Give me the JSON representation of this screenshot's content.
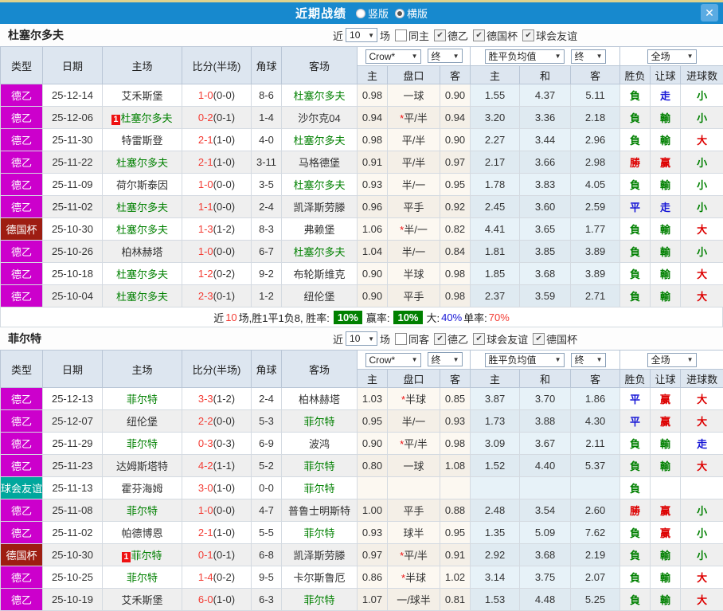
{
  "colors": {
    "topbar": "#1789ce",
    "strip": "#dfd28d",
    "close": "#5aabe3",
    "header_bg": "#dde6f0",
    "header_border": "#b9c6d6",
    "border": "#d4dae1",
    "row_odd": "#efefef",
    "odds_bg": "#fcf8f1",
    "odds_bg_alt": "#f4efe7",
    "avg_bg": "#e7f2f8",
    "avg_bg_alt": "#dfeaf1",
    "focus": "#008000",
    "score": "#f33b33",
    "res_red": "#dd0000",
    "res_green": "#008000",
    "res_blue": "#1616d6",
    "badge_green": "#008000",
    "badge_red": "#ee1111"
  },
  "league_colors": {
    "德乙": "#cc00cc",
    "德国杯": "#9e1d12",
    "球会友谊": "#00a79d"
  },
  "result_color_map": {
    "勝": "red",
    "赢": "red",
    "大": "red",
    "負": "green",
    "輸": "green",
    "小": "green",
    "平": "blue",
    "走": "blue"
  },
  "topbar": {
    "title": "近期战绩",
    "close_label": "✕",
    "radios": [
      {
        "label": "竖版",
        "checked": false
      },
      {
        "label": "横版",
        "checked": true
      }
    ]
  },
  "table_header": {
    "cols": [
      "类型",
      "日期",
      "主场",
      "比分(半场)",
      "角球",
      "客场"
    ],
    "group_odds": {
      "selects": [
        "Crow*",
        "终"
      ],
      "subcols": [
        "主",
        "盘口",
        "客"
      ]
    },
    "group_avg": {
      "selects": [
        "胜平负均值",
        "终"
      ],
      "subcols": [
        "主",
        "和",
        "客"
      ]
    },
    "group_result": {
      "selects": [
        "全场"
      ],
      "subcols": [
        "胜负",
        "让球",
        "进球数"
      ]
    }
  },
  "sections": [
    {
      "team": "杜塞尔多夫",
      "controls": {
        "prefix": "近",
        "count": "10",
        "suffix": "场",
        "filters": [
          {
            "label": "同主",
            "checked": false
          },
          {
            "label": "德乙",
            "checked": true
          },
          {
            "label": "德国杯",
            "checked": true
          },
          {
            "label": "球会友谊",
            "checked": true
          }
        ]
      },
      "rows": [
        {
          "league": "德乙",
          "date": "25-12-14",
          "home": "艾禾斯堡",
          "home_focus": false,
          "home_badge": "",
          "score": "1-0",
          "half": "(0-0)",
          "corner": "8-6",
          "away": "杜塞尔多夫",
          "away_focus": true,
          "away_badge": "",
          "odds": [
            "0.98",
            "一球",
            "0.90"
          ],
          "avg": [
            "1.55",
            "4.37",
            "5.11"
          ],
          "results": [
            "負",
            "走",
            "小"
          ]
        },
        {
          "league": "德乙",
          "date": "25-12-06",
          "home": "杜塞尔多夫",
          "home_focus": true,
          "home_badge": "1",
          "score": "0-2",
          "half": "(0-1)",
          "corner": "1-4",
          "away": "沙尔克04",
          "away_focus": false,
          "away_badge": "",
          "odds": [
            "0.94",
            "*平/半",
            "0.94"
          ],
          "avg": [
            "3.20",
            "3.36",
            "2.18"
          ],
          "results": [
            "負",
            "輸",
            "小"
          ]
        },
        {
          "league": "德乙",
          "date": "25-11-30",
          "home": "特雷斯登",
          "home_focus": false,
          "home_badge": "",
          "score": "2-1",
          "half": "(1-0)",
          "corner": "4-0",
          "away": "杜塞尔多夫",
          "away_focus": true,
          "away_badge": "",
          "odds": [
            "0.98",
            "平/半",
            "0.90"
          ],
          "avg": [
            "2.27",
            "3.44",
            "2.96"
          ],
          "results": [
            "負",
            "輸",
            "大"
          ]
        },
        {
          "league": "德乙",
          "date": "25-11-22",
          "home": "杜塞尔多夫",
          "home_focus": true,
          "home_badge": "",
          "score": "2-1",
          "half": "(1-0)",
          "corner": "3-11",
          "away": "马格德堡",
          "away_focus": false,
          "away_badge": "",
          "odds": [
            "0.91",
            "平/半",
            "0.97"
          ],
          "avg": [
            "2.17",
            "3.66",
            "2.98"
          ],
          "results": [
            "勝",
            "赢",
            "小"
          ]
        },
        {
          "league": "德乙",
          "date": "25-11-09",
          "home": "荷尔斯泰因",
          "home_focus": false,
          "home_badge": "",
          "score": "1-0",
          "half": "(0-0)",
          "corner": "3-5",
          "away": "杜塞尔多夫",
          "away_focus": true,
          "away_badge": "",
          "odds": [
            "0.93",
            "半/一",
            "0.95"
          ],
          "avg": [
            "1.78",
            "3.83",
            "4.05"
          ],
          "results": [
            "負",
            "輸",
            "小"
          ]
        },
        {
          "league": "德乙",
          "date": "25-11-02",
          "home": "杜塞尔多夫",
          "home_focus": true,
          "home_badge": "",
          "score": "1-1",
          "half": "(0-0)",
          "corner": "2-4",
          "away": "凯泽斯劳滕",
          "away_focus": false,
          "away_badge": "",
          "odds": [
            "0.96",
            "平手",
            "0.92"
          ],
          "avg": [
            "2.45",
            "3.60",
            "2.59"
          ],
          "results": [
            "平",
            "走",
            "小"
          ]
        },
        {
          "league": "德国杯",
          "date": "25-10-30",
          "home": "杜塞尔多夫",
          "home_focus": true,
          "home_badge": "",
          "score": "1-3",
          "half": "(1-2)",
          "corner": "8-3",
          "away": "弗赖堡",
          "away_focus": false,
          "away_badge": "",
          "odds": [
            "1.06",
            "*半/一",
            "0.82"
          ],
          "avg": [
            "4.41",
            "3.65",
            "1.77"
          ],
          "results": [
            "負",
            "輸",
            "大"
          ]
        },
        {
          "league": "德乙",
          "date": "25-10-26",
          "home": "柏林赫塔",
          "home_focus": false,
          "home_badge": "",
          "score": "1-0",
          "half": "(0-0)",
          "corner": "6-7",
          "away": "杜塞尔多夫",
          "away_focus": true,
          "away_badge": "",
          "odds": [
            "1.04",
            "半/一",
            "0.84"
          ],
          "avg": [
            "1.81",
            "3.85",
            "3.89"
          ],
          "results": [
            "負",
            "輸",
            "小"
          ]
        },
        {
          "league": "德乙",
          "date": "25-10-18",
          "home": "杜塞尔多夫",
          "home_focus": true,
          "home_badge": "",
          "score": "1-2",
          "half": "(0-2)",
          "corner": "9-2",
          "away": "布轮斯维克",
          "away_focus": false,
          "away_badge": "",
          "odds": [
            "0.90",
            "半球",
            "0.98"
          ],
          "avg": [
            "1.85",
            "3.68",
            "3.89"
          ],
          "results": [
            "負",
            "輸",
            "大"
          ]
        },
        {
          "league": "德乙",
          "date": "25-10-04",
          "home": "杜塞尔多夫",
          "home_focus": true,
          "home_badge": "",
          "score": "2-3",
          "half": "(0-1)",
          "corner": "1-2",
          "away": "纽伦堡",
          "away_focus": false,
          "away_badge": "",
          "odds": [
            "0.90",
            "平手",
            "0.98"
          ],
          "avg": [
            "2.37",
            "3.59",
            "2.71"
          ],
          "results": [
            "負",
            "輸",
            "大"
          ]
        }
      ],
      "summary": [
        {
          "t": "近"
        },
        {
          "t": "10",
          "c": "#f33b33"
        },
        {
          "t": "场,胜1平1负8, 胜率:"
        },
        {
          "t": "10%",
          "badge": true
        },
        {
          "t": "赢率:"
        },
        {
          "t": "10%",
          "badge": true
        },
        {
          "t": "大:"
        },
        {
          "t": "40%",
          "c": "#1616d6"
        },
        {
          "t": " 单率:"
        },
        {
          "t": "70%",
          "c": "#f33b33"
        }
      ]
    },
    {
      "team": "菲尔特",
      "controls": {
        "prefix": "近",
        "count": "10",
        "suffix": "场",
        "filters": [
          {
            "label": "同客",
            "checked": false
          },
          {
            "label": "德乙",
            "checked": true
          },
          {
            "label": "球会友谊",
            "checked": true
          },
          {
            "label": "德国杯",
            "checked": true
          }
        ]
      },
      "rows": [
        {
          "league": "德乙",
          "date": "25-12-13",
          "home": "菲尔特",
          "home_focus": true,
          "home_badge": "",
          "score": "3-3",
          "half": "(1-2)",
          "corner": "2-4",
          "away": "柏林赫塔",
          "away_focus": false,
          "away_badge": "",
          "odds": [
            "1.03",
            "*半球",
            "0.85"
          ],
          "avg": [
            "3.87",
            "3.70",
            "1.86"
          ],
          "results": [
            "平",
            "赢",
            "大"
          ]
        },
        {
          "league": "德乙",
          "date": "25-12-07",
          "home": "纽伦堡",
          "home_focus": false,
          "home_badge": "",
          "score": "2-2",
          "half": "(0-0)",
          "corner": "5-3",
          "away": "菲尔特",
          "away_focus": true,
          "away_badge": "",
          "odds": [
            "0.95",
            "半/一",
            "0.93"
          ],
          "avg": [
            "1.73",
            "3.88",
            "4.30"
          ],
          "results": [
            "平",
            "赢",
            "大"
          ]
        },
        {
          "league": "德乙",
          "date": "25-11-29",
          "home": "菲尔特",
          "home_focus": true,
          "home_badge": "",
          "score": "0-3",
          "half": "(0-3)",
          "corner": "6-9",
          "away": "波鸿",
          "away_focus": false,
          "away_badge": "",
          "odds": [
            "0.90",
            "*平/半",
            "0.98"
          ],
          "avg": [
            "3.09",
            "3.67",
            "2.11"
          ],
          "results": [
            "負",
            "輸",
            "走"
          ]
        },
        {
          "league": "德乙",
          "date": "25-11-23",
          "home": "达姆斯塔特",
          "home_focus": false,
          "home_badge": "",
          "score": "4-2",
          "half": "(1-1)",
          "corner": "5-2",
          "away": "菲尔特",
          "away_focus": true,
          "away_badge": "",
          "odds": [
            "0.80",
            "一球",
            "1.08"
          ],
          "avg": [
            "1.52",
            "4.40",
            "5.37"
          ],
          "results": [
            "負",
            "輸",
            "大"
          ]
        },
        {
          "league": "球会友谊",
          "date": "25-11-13",
          "home": "霍芬海姆",
          "home_focus": false,
          "home_badge": "",
          "score": "3-0",
          "half": "(1-0)",
          "corner": "0-0",
          "away": "菲尔特",
          "away_focus": true,
          "away_badge": "",
          "odds": [
            "",
            "",
            ""
          ],
          "avg": [
            "",
            "",
            ""
          ],
          "results": [
            "負",
            "",
            ""
          ]
        },
        {
          "league": "德乙",
          "date": "25-11-08",
          "home": "菲尔特",
          "home_focus": true,
          "home_badge": "",
          "score": "1-0",
          "half": "(0-0)",
          "corner": "4-7",
          "away": "普鲁士明斯特",
          "away_focus": false,
          "away_badge": "",
          "odds": [
            "1.00",
            "平手",
            "0.88"
          ],
          "avg": [
            "2.48",
            "3.54",
            "2.60"
          ],
          "results": [
            "勝",
            "赢",
            "小"
          ]
        },
        {
          "league": "德乙",
          "date": "25-11-02",
          "home": "帕德博恩",
          "home_focus": false,
          "home_badge": "",
          "score": "2-1",
          "half": "(1-0)",
          "corner": "5-5",
          "away": "菲尔特",
          "away_focus": true,
          "away_badge": "",
          "odds": [
            "0.93",
            "球半",
            "0.95"
          ],
          "avg": [
            "1.35",
            "5.09",
            "7.62"
          ],
          "results": [
            "負",
            "赢",
            "小"
          ]
        },
        {
          "league": "德国杯",
          "date": "25-10-30",
          "home": "菲尔特",
          "home_focus": true,
          "home_badge": "1",
          "score": "0-1",
          "half": "(0-1)",
          "corner": "6-8",
          "away": "凯泽斯劳滕",
          "away_focus": false,
          "away_badge": "",
          "odds": [
            "0.97",
            "*平/半",
            "0.91"
          ],
          "avg": [
            "2.92",
            "3.68",
            "2.19"
          ],
          "results": [
            "負",
            "輸",
            "小"
          ]
        },
        {
          "league": "德乙",
          "date": "25-10-25",
          "home": "菲尔特",
          "home_focus": true,
          "home_badge": "",
          "score": "1-4",
          "half": "(0-2)",
          "corner": "9-5",
          "away": "卡尔斯鲁厄",
          "away_focus": false,
          "away_badge": "",
          "odds": [
            "0.86",
            "*半球",
            "1.02"
          ],
          "avg": [
            "3.14",
            "3.75",
            "2.07"
          ],
          "results": [
            "負",
            "輸",
            "大"
          ]
        },
        {
          "league": "德乙",
          "date": "25-10-19",
          "home": "艾禾斯堡",
          "home_focus": false,
          "home_badge": "",
          "score": "6-0",
          "half": "(1-0)",
          "corner": "6-3",
          "away": "菲尔特",
          "away_focus": true,
          "away_badge": "",
          "odds": [
            "1.07",
            "一/球半",
            "0.81"
          ],
          "avg": [
            "1.53",
            "4.48",
            "5.25"
          ],
          "results": [
            "負",
            "輸",
            "大"
          ]
        }
      ],
      "summary": []
    }
  ]
}
